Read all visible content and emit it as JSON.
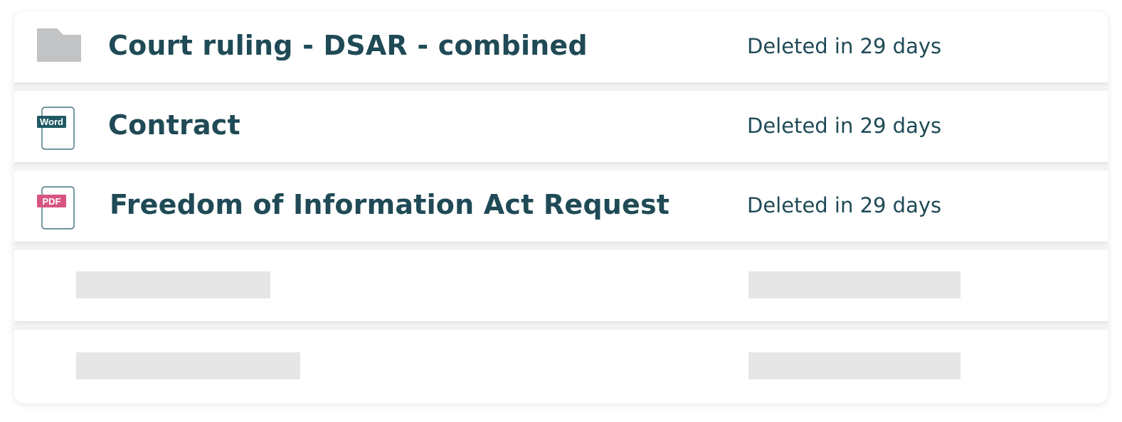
{
  "items": [
    {
      "name": "Court ruling - DSAR - combined",
      "status": "Deleted in 29 days",
      "icon": "folder-icon"
    },
    {
      "name": "Contract",
      "status": "Deleted in 29 days",
      "icon": "word-file-icon",
      "badge": "Word"
    },
    {
      "name": "Freedom of Information Act Request",
      "status": "Deleted in 29 days",
      "icon": "pdf-file-icon",
      "badge": "PDF"
    }
  ],
  "colors": {
    "text": "#1f4a56",
    "folder": "#c2c3c5",
    "word_badge": "#1f5964",
    "pdf_badge": "#d8557f",
    "skeleton": "#e6e6e6"
  }
}
